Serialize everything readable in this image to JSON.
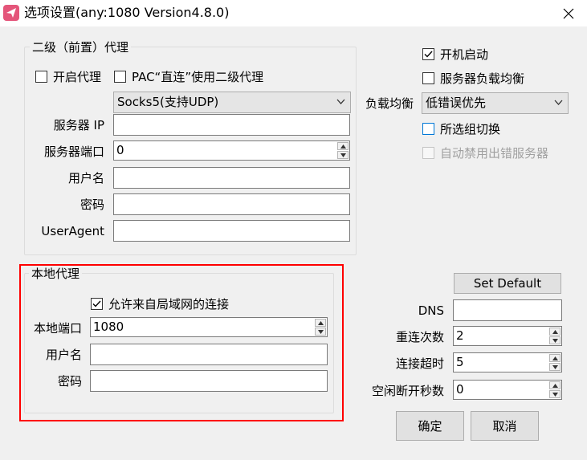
{
  "window": {
    "title": "选项设置(any:1080 Version4.8.0)",
    "icon": "paper-plane-icon",
    "close_icon": "close-icon"
  },
  "upstream": {
    "group_title": "二级（前置）代理",
    "enable_label": "开启代理",
    "enable_checked": false,
    "pac_label": "PAC“直连”使用二级代理",
    "pac_checked": false,
    "proxy_type": "Socks5(支持UDP)",
    "server_ip_label": "服务器 IP",
    "server_ip_value": "",
    "server_port_label": "服务器端口",
    "server_port_value": "0",
    "username_label": "用户名",
    "username_value": "",
    "password_label": "密码",
    "password_value": "",
    "useragent_label": "UserAgent",
    "useragent_value": ""
  },
  "options": {
    "autostart_label": "开机启动",
    "autostart_checked": true,
    "load_balance_label": "服务器负载均衡",
    "load_balance_checked": false,
    "lb_mode_label": "负载均衡",
    "lb_mode_value": "低错误优先",
    "switch_group_label": "所选组切换",
    "switch_group_checked": false,
    "auto_disable_label": "自动禁用出错服务器",
    "auto_disable_checked": false
  },
  "local": {
    "group_title": "本地代理",
    "allow_lan_label": "允许来自局域网的连接",
    "allow_lan_checked": true,
    "port_label": "本地端口",
    "port_value": "1080",
    "username_label": "用户名",
    "username_value": "",
    "password_label": "密码",
    "password_value": ""
  },
  "network": {
    "set_default_label": "Set Default",
    "dns_label": "DNS",
    "dns_value": "",
    "reconnect_label": "重连次数",
    "reconnect_value": "2",
    "timeout_label": "连接超时",
    "timeout_value": "5",
    "idle_label": "空闲断开秒数",
    "idle_value": "0"
  },
  "buttons": {
    "ok": "确定",
    "cancel": "取消"
  },
  "colors": {
    "highlight": "#ff0000",
    "focus": "#0078d7",
    "app_icon": "#e4557a"
  }
}
